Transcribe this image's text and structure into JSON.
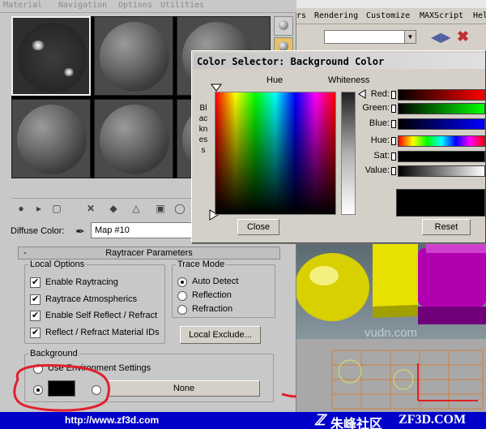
{
  "material_editor": {
    "menu": [
      "Material",
      "Navigation",
      "Options",
      "Utilities"
    ],
    "diffuse_label": "Diffuse Color:",
    "map_name": "Map #10",
    "rollout": {
      "minus": "-",
      "title": "Raytracer Parameters"
    },
    "local_options": {
      "title": "Local Options",
      "items": [
        {
          "label": "Enable Raytracing",
          "checked": true
        },
        {
          "label": "Raytrace Atmospherics",
          "checked": true
        },
        {
          "label": "Enable Self Reflect / Refract",
          "checked": true
        },
        {
          "label": "Reflect / Refract Material IDs",
          "checked": true
        }
      ]
    },
    "trace_mode": {
      "title": "Trace Mode",
      "options": [
        "Auto Detect",
        "Reflection",
        "Refraction"
      ],
      "selected": "Auto Detect"
    },
    "local_exclude_label": "Local Exclude...",
    "background": {
      "title": "Background",
      "use_env_label": "Use Environment Settings",
      "color_swatch": "#000000",
      "map_button_label": "None"
    }
  },
  "main_window": {
    "menu": [
      "rs",
      "Rendering",
      "Customize",
      "MAXScript",
      "Hel"
    ]
  },
  "color_selector": {
    "title": "Color Selector: Background Color",
    "hue_label": "Hue",
    "whiteness_label": "Whiteness",
    "blackness_label": "Blackness",
    "channels": [
      {
        "label": "Red:",
        "gradient": [
          "#000000",
          "#ff0000"
        ]
      },
      {
        "label": "Green:",
        "gradient": [
          "#000000",
          "#00ff00"
        ]
      },
      {
        "label": "Blue:",
        "gradient": [
          "#000000",
          "#0000ff"
        ]
      },
      {
        "label": "Hue:",
        "gradient": [
          "#ff0000",
          "#ffff00",
          "#00ff00",
          "#00ffff",
          "#0000ff",
          "#ff00ff",
          "#ff0000"
        ]
      },
      {
        "label": "Sat:",
        "gradient": [
          "#000000",
          "#000000"
        ]
      },
      {
        "label": "Value:",
        "gradient": [
          "#000000",
          "#ffffff"
        ]
      }
    ],
    "current_color": "#000000",
    "close_label": "Close",
    "reset_label": "Reset"
  },
  "watermark": "vudn.com",
  "annotation": "?",
  "footer": {
    "url": "http://www.zf3d.com",
    "community": "朱峰社区",
    "brand": "ZF3D.COM"
  }
}
